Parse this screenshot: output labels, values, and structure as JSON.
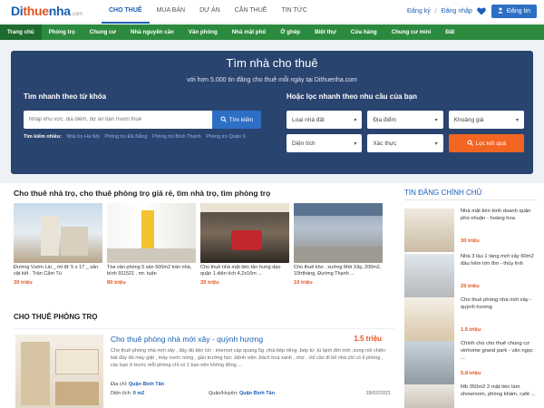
{
  "header": {
    "logo": {
      "part1": "Di",
      "part2": "thue",
      "part3": "nha",
      "tld": ".com"
    },
    "nav": [
      {
        "label": "CHO THUÊ",
        "active": true
      },
      {
        "label": "MUA BÁN",
        "active": false
      },
      {
        "label": "DỰ ÁN",
        "active": false
      },
      {
        "label": "CẦN THUÊ",
        "active": false
      },
      {
        "label": "TIN TỨC",
        "active": false
      }
    ],
    "register": "Đăng ký",
    "separator": "/",
    "login": "Đăng nhập",
    "post_button": "Đăng tin",
    "heart_icon": "heart-icon",
    "post_icon": "user-plus-icon"
  },
  "green_nav": [
    {
      "label": "Trang chủ",
      "active": true
    },
    {
      "label": "Phòng trọ",
      "active": false
    },
    {
      "label": "Chung cư",
      "active": false
    },
    {
      "label": "Nhà nguyên căn",
      "active": false
    },
    {
      "label": "Văn phòng",
      "active": false
    },
    {
      "label": "Nhà mặt phố",
      "active": false
    },
    {
      "label": "Ở ghép",
      "active": false
    },
    {
      "label": "Biệt thự",
      "active": false
    },
    {
      "label": "Cửa hàng",
      "active": false
    },
    {
      "label": "Chung cư mini",
      "active": false
    },
    {
      "label": "Đất",
      "active": false
    }
  ],
  "hero": {
    "title": "Tìm nhà cho thuê",
    "subtitle": "với hơn 5.000 tin đăng cho thuê mỗi ngày tại Dithuenha.com",
    "quick_search_title": "Tìm nhanh theo từ khóa",
    "search_placeholder": "Nhập khu vực, địa điểm, dự án bạn muốn thuê",
    "search_button": "Tìm kiếm",
    "popular_label": "Tìm kiếm nhiều:",
    "popular_keywords": [
      "Nhà trọ Hà Nội",
      "Phòng trọ Đà Nẵng",
      "Phòng trọ Bình Thạnh",
      "Phòng trọ Quận 9"
    ],
    "filter_title": "Hoặc lọc nhanh theo nhu cầu của bạn",
    "filters": [
      "Loại nhà đất",
      "Địa điểm",
      "Khoảng giá",
      "Diện tích",
      "Xác thực"
    ],
    "filter_button": "Lọc kết quả"
  },
  "featured": {
    "title": "Cho thuê nhà trọ, cho thuê phòng trọ giá rẻ, tìm nhà trọ, tìm phòng trọ",
    "cards": [
      {
        "text": "Đường Vườn Lài _ mt đt: 5 x 17 _ sẵn vật kết . Trần Cẩm Tú",
        "price": "30 triệu"
      },
      {
        "text": "Tòa văn phòng 5 sàn 500m2 trần nhà, bình 911521 . mr. tuấn",
        "price": "80 triệu"
      },
      {
        "text": "Cho thuê nhà mặt tiền tân hưng dạo quận 1 diện tích 4,2x16m ...",
        "price": "35 triệu"
      },
      {
        "text": "Cho thuê kho . xưởng Mới Xây, 200m2, 10trtháng, Đường Thạnh ...",
        "price": "10 triệu"
      }
    ]
  },
  "listing": {
    "section_title": "CHO THUÊ PHÒNG TRỌ",
    "items": [
      {
        "title": "Cho thuê phòng nhà mới xây - quỳnh hương",
        "price": "1.5 triệu",
        "description": "Cho thuê phòng nhà mới xây , đầy đủ tiện ích : internet cáp quang 5g ,nhà bếp riêng ,bếp từ ,tủ lạnh đời mới ,xong nồi chiên bát đầy đủ máy giặt , máy nước nóng , gần trường học ,bệnh viện ,bách hoá xanh , chợ . chỉ cần đi bỏ nhà chỉ có 6 phòng , các bạn ở trước mỗi phòng chỉ có 1 bạn nên không đông ...",
        "address_label": "Địa chỉ:",
        "address": "Quận Bình Tân",
        "area_label": "Diện tích:",
        "area": "0 m2",
        "district_label": "Quận/Huyện:",
        "district": "Quận Bình Tân",
        "date": "18/02/2021"
      }
    ]
  },
  "sidebar": {
    "title": "TIN ĐĂNG CHÍNH CHỦ",
    "items": [
      {
        "text": "Nhà mặt tiền kinh doanh quận phú nhuận - hoàng hoa",
        "price": "30 triệu"
      },
      {
        "text": "Nhà 3 lầu 1 tầng mới xây 60m2 đầu hẻm lớn 8m - thủy linh",
        "price": "25 triệu"
      },
      {
        "text": "Cho thuê phòng nhà mới xây - quỳnh hương",
        "price": "1.5 triệu"
      },
      {
        "text": "Chính chủ cho thuê chung cư vinhome grand park - văn ngọc ...",
        "price": "5.8 triệu"
      },
      {
        "text": "Mb 350m2 2 mặt tiền làm showroom, phòng khám, café ...",
        "price": ""
      }
    ]
  }
}
